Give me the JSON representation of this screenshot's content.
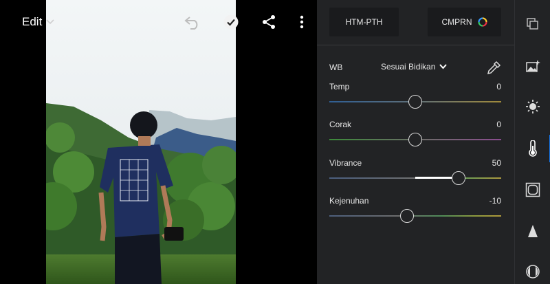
{
  "topbar": {
    "edit_label": "Edit",
    "icons": [
      "chevron-down-icon",
      "undo-icon",
      "check-icon",
      "share-icon",
      "more-icon"
    ]
  },
  "panel": {
    "htm_pth_label": "HTM-PTH",
    "cmprn_label": "CMPRN",
    "wb": {
      "label": "WB",
      "value": "Sesuai Bidikan"
    },
    "sliders": [
      {
        "label": "Temp",
        "value": "0",
        "fraction": 0.5
      },
      {
        "label": "Corak",
        "value": "0",
        "fraction": 0.5
      },
      {
        "label": "Vibrance",
        "value": "50",
        "fraction": 0.75
      },
      {
        "label": "Kejenuhan",
        "value": "-10",
        "fraction": 0.45
      }
    ]
  },
  "rail": {
    "icons": [
      "layers-icon",
      "enhance-photo-icon",
      "light-icon",
      "color-temperature-icon",
      "effects-icon",
      "detail-icon",
      "optics-icon"
    ],
    "active": "color-temperature-icon"
  },
  "colors": {
    "panel_bg": "#222325",
    "button_bg": "#1a1b1d",
    "accent": "#1473e6",
    "text": "#e6e6e6"
  }
}
